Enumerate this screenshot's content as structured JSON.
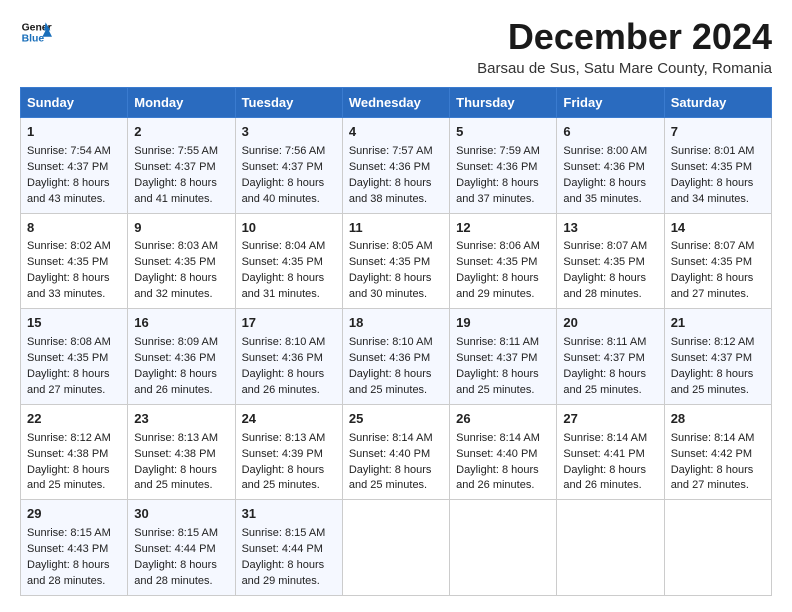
{
  "logo": {
    "line1": "General",
    "line2": "Blue",
    "icon_color": "#1a6fba"
  },
  "title": "December 2024",
  "subtitle": "Barsau de Sus, Satu Mare County, Romania",
  "days_of_week": [
    "Sunday",
    "Monday",
    "Tuesday",
    "Wednesday",
    "Thursday",
    "Friday",
    "Saturday"
  ],
  "weeks": [
    [
      {
        "day": "1",
        "sunrise": "Sunrise: 7:54 AM",
        "sunset": "Sunset: 4:37 PM",
        "daylight": "Daylight: 8 hours and 43 minutes."
      },
      {
        "day": "2",
        "sunrise": "Sunrise: 7:55 AM",
        "sunset": "Sunset: 4:37 PM",
        "daylight": "Daylight: 8 hours and 41 minutes."
      },
      {
        "day": "3",
        "sunrise": "Sunrise: 7:56 AM",
        "sunset": "Sunset: 4:37 PM",
        "daylight": "Daylight: 8 hours and 40 minutes."
      },
      {
        "day": "4",
        "sunrise": "Sunrise: 7:57 AM",
        "sunset": "Sunset: 4:36 PM",
        "daylight": "Daylight: 8 hours and 38 minutes."
      },
      {
        "day": "5",
        "sunrise": "Sunrise: 7:59 AM",
        "sunset": "Sunset: 4:36 PM",
        "daylight": "Daylight: 8 hours and 37 minutes."
      },
      {
        "day": "6",
        "sunrise": "Sunrise: 8:00 AM",
        "sunset": "Sunset: 4:36 PM",
        "daylight": "Daylight: 8 hours and 35 minutes."
      },
      {
        "day": "7",
        "sunrise": "Sunrise: 8:01 AM",
        "sunset": "Sunset: 4:35 PM",
        "daylight": "Daylight: 8 hours and 34 minutes."
      }
    ],
    [
      {
        "day": "8",
        "sunrise": "Sunrise: 8:02 AM",
        "sunset": "Sunset: 4:35 PM",
        "daylight": "Daylight: 8 hours and 33 minutes."
      },
      {
        "day": "9",
        "sunrise": "Sunrise: 8:03 AM",
        "sunset": "Sunset: 4:35 PM",
        "daylight": "Daylight: 8 hours and 32 minutes."
      },
      {
        "day": "10",
        "sunrise": "Sunrise: 8:04 AM",
        "sunset": "Sunset: 4:35 PM",
        "daylight": "Daylight: 8 hours and 31 minutes."
      },
      {
        "day": "11",
        "sunrise": "Sunrise: 8:05 AM",
        "sunset": "Sunset: 4:35 PM",
        "daylight": "Daylight: 8 hours and 30 minutes."
      },
      {
        "day": "12",
        "sunrise": "Sunrise: 8:06 AM",
        "sunset": "Sunset: 4:35 PM",
        "daylight": "Daylight: 8 hours and 29 minutes."
      },
      {
        "day": "13",
        "sunrise": "Sunrise: 8:07 AM",
        "sunset": "Sunset: 4:35 PM",
        "daylight": "Daylight: 8 hours and 28 minutes."
      },
      {
        "day": "14",
        "sunrise": "Sunrise: 8:07 AM",
        "sunset": "Sunset: 4:35 PM",
        "daylight": "Daylight: 8 hours and 27 minutes."
      }
    ],
    [
      {
        "day": "15",
        "sunrise": "Sunrise: 8:08 AM",
        "sunset": "Sunset: 4:35 PM",
        "daylight": "Daylight: 8 hours and 27 minutes."
      },
      {
        "day": "16",
        "sunrise": "Sunrise: 8:09 AM",
        "sunset": "Sunset: 4:36 PM",
        "daylight": "Daylight: 8 hours and 26 minutes."
      },
      {
        "day": "17",
        "sunrise": "Sunrise: 8:10 AM",
        "sunset": "Sunset: 4:36 PM",
        "daylight": "Daylight: 8 hours and 26 minutes."
      },
      {
        "day": "18",
        "sunrise": "Sunrise: 8:10 AM",
        "sunset": "Sunset: 4:36 PM",
        "daylight": "Daylight: 8 hours and 25 minutes."
      },
      {
        "day": "19",
        "sunrise": "Sunrise: 8:11 AM",
        "sunset": "Sunset: 4:37 PM",
        "daylight": "Daylight: 8 hours and 25 minutes."
      },
      {
        "day": "20",
        "sunrise": "Sunrise: 8:11 AM",
        "sunset": "Sunset: 4:37 PM",
        "daylight": "Daylight: 8 hours and 25 minutes."
      },
      {
        "day": "21",
        "sunrise": "Sunrise: 8:12 AM",
        "sunset": "Sunset: 4:37 PM",
        "daylight": "Daylight: 8 hours and 25 minutes."
      }
    ],
    [
      {
        "day": "22",
        "sunrise": "Sunrise: 8:12 AM",
        "sunset": "Sunset: 4:38 PM",
        "daylight": "Daylight: 8 hours and 25 minutes."
      },
      {
        "day": "23",
        "sunrise": "Sunrise: 8:13 AM",
        "sunset": "Sunset: 4:38 PM",
        "daylight": "Daylight: 8 hours and 25 minutes."
      },
      {
        "day": "24",
        "sunrise": "Sunrise: 8:13 AM",
        "sunset": "Sunset: 4:39 PM",
        "daylight": "Daylight: 8 hours and 25 minutes."
      },
      {
        "day": "25",
        "sunrise": "Sunrise: 8:14 AM",
        "sunset": "Sunset: 4:40 PM",
        "daylight": "Daylight: 8 hours and 25 minutes."
      },
      {
        "day": "26",
        "sunrise": "Sunrise: 8:14 AM",
        "sunset": "Sunset: 4:40 PM",
        "daylight": "Daylight: 8 hours and 26 minutes."
      },
      {
        "day": "27",
        "sunrise": "Sunrise: 8:14 AM",
        "sunset": "Sunset: 4:41 PM",
        "daylight": "Daylight: 8 hours and 26 minutes."
      },
      {
        "day": "28",
        "sunrise": "Sunrise: 8:14 AM",
        "sunset": "Sunset: 4:42 PM",
        "daylight": "Daylight: 8 hours and 27 minutes."
      }
    ],
    [
      {
        "day": "29",
        "sunrise": "Sunrise: 8:15 AM",
        "sunset": "Sunset: 4:43 PM",
        "daylight": "Daylight: 8 hours and 28 minutes."
      },
      {
        "day": "30",
        "sunrise": "Sunrise: 8:15 AM",
        "sunset": "Sunset: 4:44 PM",
        "daylight": "Daylight: 8 hours and 28 minutes."
      },
      {
        "day": "31",
        "sunrise": "Sunrise: 8:15 AM",
        "sunset": "Sunset: 4:44 PM",
        "daylight": "Daylight: 8 hours and 29 minutes."
      },
      null,
      null,
      null,
      null
    ]
  ]
}
